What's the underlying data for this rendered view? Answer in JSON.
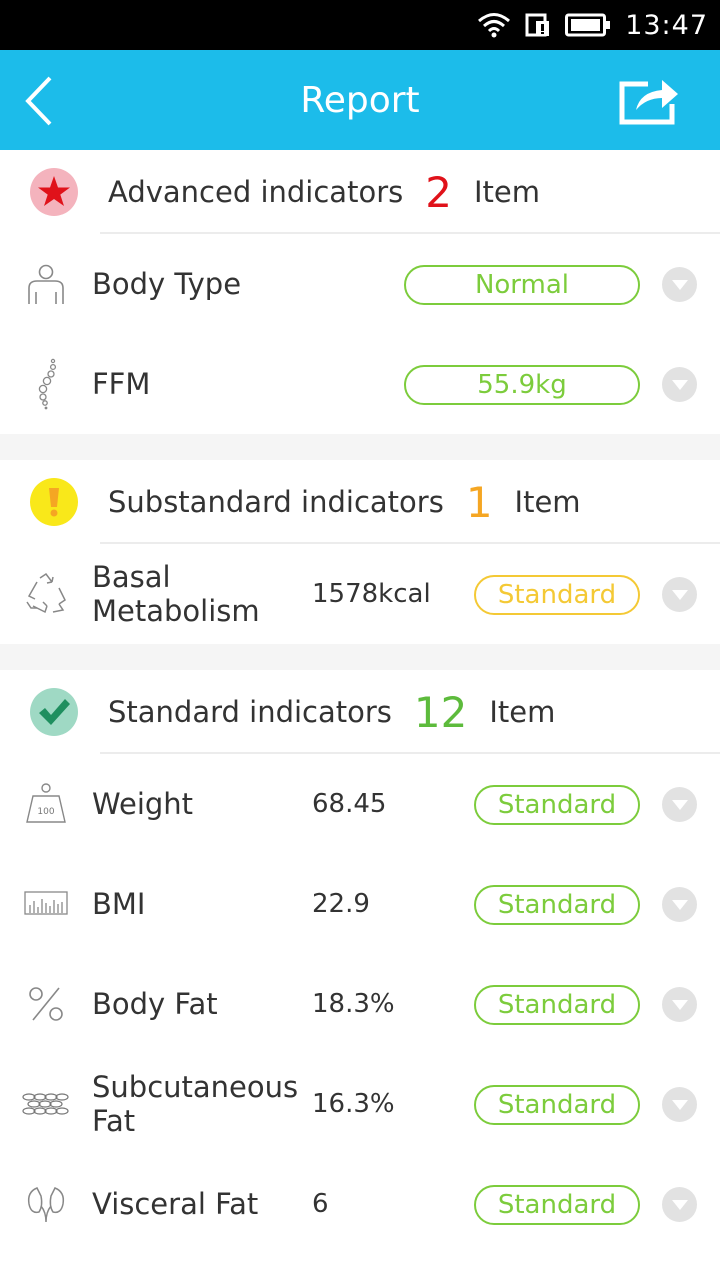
{
  "status": {
    "time": "13:47"
  },
  "header": {
    "title": "Report"
  },
  "advanced": {
    "title": "Advanced indicators",
    "count": "2",
    "unit": "Item",
    "rows": [
      {
        "label": "Body Type",
        "value": "",
        "status": "Normal"
      },
      {
        "label": "FFM",
        "value": "",
        "status": "55.9kg"
      }
    ]
  },
  "substandard": {
    "title": "Substandard indicators",
    "count": "1",
    "unit": "Item",
    "rows": [
      {
        "label": "Basal Metabolism",
        "value": "1578kcal",
        "status": "Standard"
      }
    ]
  },
  "standard": {
    "title": "Standard indicators",
    "count": "12",
    "unit": "Item",
    "rows": [
      {
        "label": "Weight",
        "value": "68.45",
        "status": "Standard",
        "icon_text": "100"
      },
      {
        "label": "BMI",
        "value": "22.9",
        "status": "Standard"
      },
      {
        "label": "Body Fat",
        "value": "18.3%",
        "status": "Standard"
      },
      {
        "label": "Subcutaneous Fat",
        "value": "16.3%",
        "status": "Standard"
      },
      {
        "label": "Visceral Fat",
        "value": "6",
        "status": "Standard"
      }
    ]
  },
  "colors": {
    "appbar": "#1cbcea",
    "advanced_count": "#e0121a",
    "substandard_count": "#f5a623",
    "standard_count": "#5dbb3c",
    "standard_pill": "#7ccc3c",
    "substandard_pill": "#f4c935"
  },
  "icons": {
    "back": "chevron-left-icon",
    "share": "share-icon",
    "advanced_badge": "star-icon",
    "substandard_badge": "exclamation-icon",
    "standard_badge": "checkmark-icon",
    "expand": "triangle-down-icon"
  }
}
